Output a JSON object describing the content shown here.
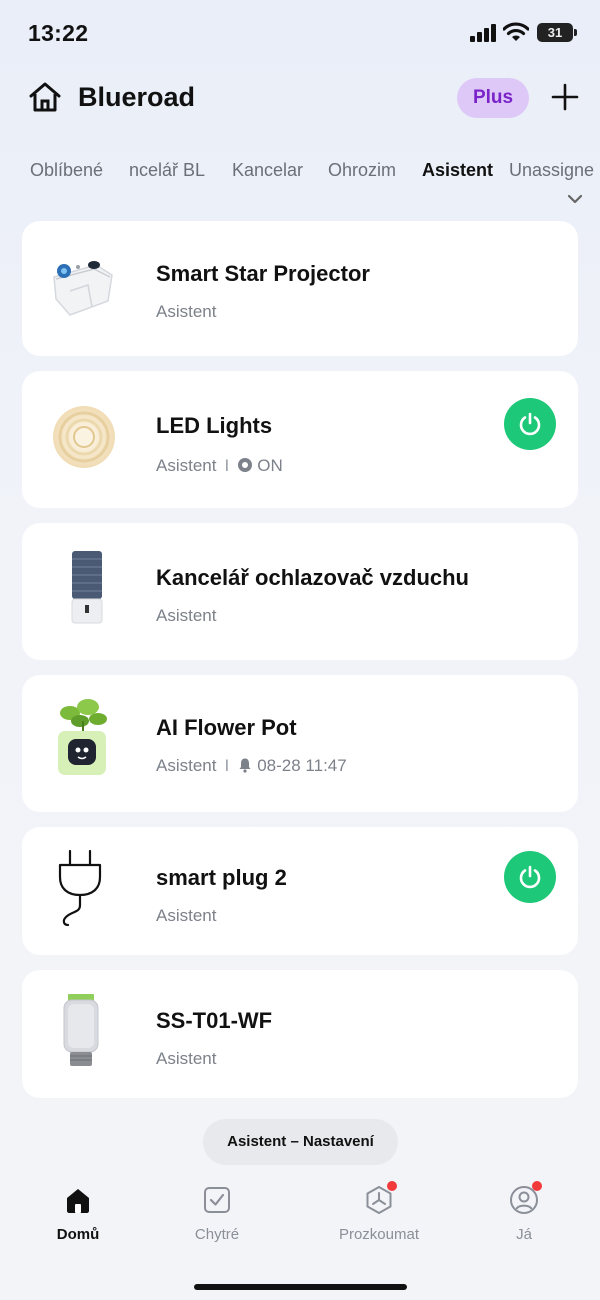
{
  "status_bar": {
    "time": "13:22",
    "battery": "31"
  },
  "header": {
    "title": "Blueroad",
    "plus_label": "Plus"
  },
  "tabs": [
    {
      "label": "Oblíbené"
    },
    {
      "label": "ncelář BL"
    },
    {
      "label": "Kancelar"
    },
    {
      "label": "Ohrozim"
    },
    {
      "label": "Asistent",
      "active": true
    },
    {
      "label": "Unassigne"
    }
  ],
  "devices": [
    {
      "name": "Smart Star Projector",
      "room": "Asistent",
      "icon": "star-projector-image"
    },
    {
      "name": "LED Lights",
      "room": "Asistent",
      "separator": "I",
      "state": "ON",
      "power": true,
      "icon": "led-strip-image"
    },
    {
      "name": "Kancelář ochlazovač vzduchu",
      "room": "Asistent",
      "icon": "air-cooler-image"
    },
    {
      "name": "AI Flower Pot",
      "room": "Asistent",
      "separator": "I",
      "alarm": "08-28 11:47",
      "icon": "flower-pot-image"
    },
    {
      "name": "smart plug 2",
      "room": "Asistent",
      "power": true,
      "icon": "plug-image"
    },
    {
      "name": "SS-T01-WF",
      "room": "Asistent",
      "icon": "thermostat-valve-image"
    }
  ],
  "scene_pill": "Asistent – Nastavení",
  "nav": [
    {
      "label": "Domů",
      "icon": "home-icon",
      "active": true
    },
    {
      "label": "Chytré",
      "icon": "checkbox-icon"
    },
    {
      "label": "Prozkoumat",
      "icon": "explore-icon",
      "badge": true
    },
    {
      "label": "Já",
      "icon": "profile-icon",
      "badge": true
    }
  ],
  "colors": {
    "accent_green": "#1ec879",
    "plus_bg": "#ddc8f7",
    "plus_text": "#7a23c9",
    "badge_red": "#f23a3a"
  }
}
